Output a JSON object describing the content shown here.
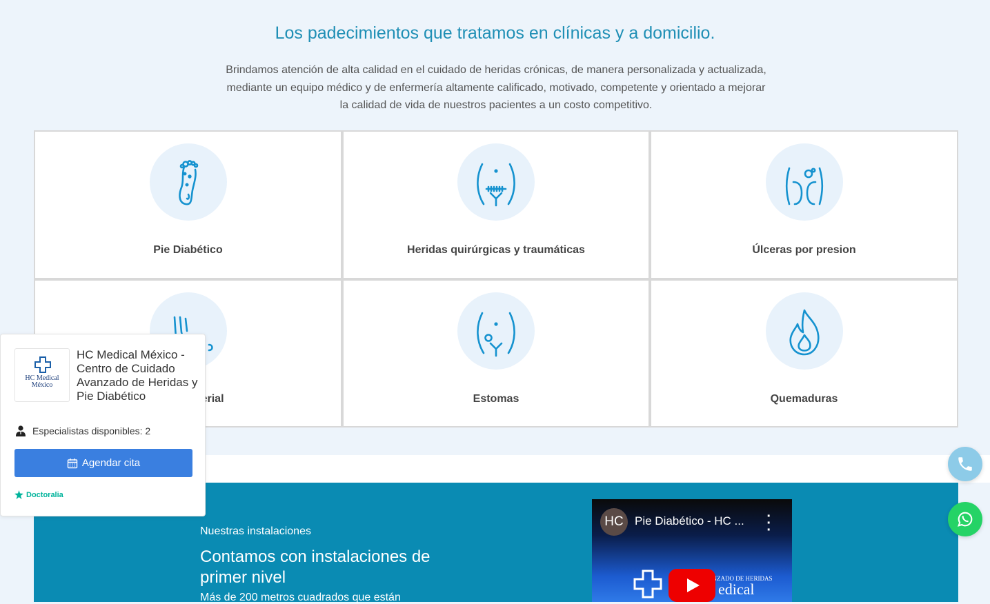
{
  "hero": {
    "title": "Los padecimientos que tratamos en clínicas y a domicilio.",
    "description": "Brindamos atención de alta calidad en el cuidado de heridas crónicas, de manera personalizada y actualizada, mediante un equipo médico y de enfermería altamente calificado, motivado, competente y orientado a mejorar la calidad de vida de nuestros pacientes a un costo competitivo."
  },
  "conditions": [
    {
      "label": "Pie Diabético",
      "icon": "foot-icon"
    },
    {
      "label": "Heridas quirúrgicas y traumáticas",
      "icon": "surgical-abdomen-icon"
    },
    {
      "label": "Úlceras por presion",
      "icon": "pressure-ulcer-icon"
    },
    {
      "label": "nosa / arterial",
      "icon": "leg-ulcer-icon"
    },
    {
      "label": "Estomas",
      "icon": "stoma-icon"
    },
    {
      "label": "Quemaduras",
      "icon": "flame-icon"
    }
  ],
  "facilities": {
    "kicker": "Nuestras instalaciones",
    "heading": "Contamos con instalaciones de primer nivel",
    "sub": "Más de 200 metros cuadrados que están",
    "video": {
      "avatar": "HC",
      "title": "Pie Diabético - HC ...",
      "brand_small": "ANZADO DE HERIDAS",
      "brand_big": "edical"
    }
  },
  "widget": {
    "logo_line1": "HC Medical",
    "logo_line2": "México",
    "name": "HC Medical México - Centro de Cuidado Avanzado de Heridas y Pie Diabético",
    "specialists": "Especialistas disponibles: 2",
    "button": "Agendar cita",
    "brand": "Doctoralia"
  },
  "colors": {
    "accent": "#1f8fb5",
    "facility_bg": "#0a8bb3",
    "button": "#3a7fe0",
    "whatsapp": "#25d366",
    "phone": "#8dcbe8"
  }
}
